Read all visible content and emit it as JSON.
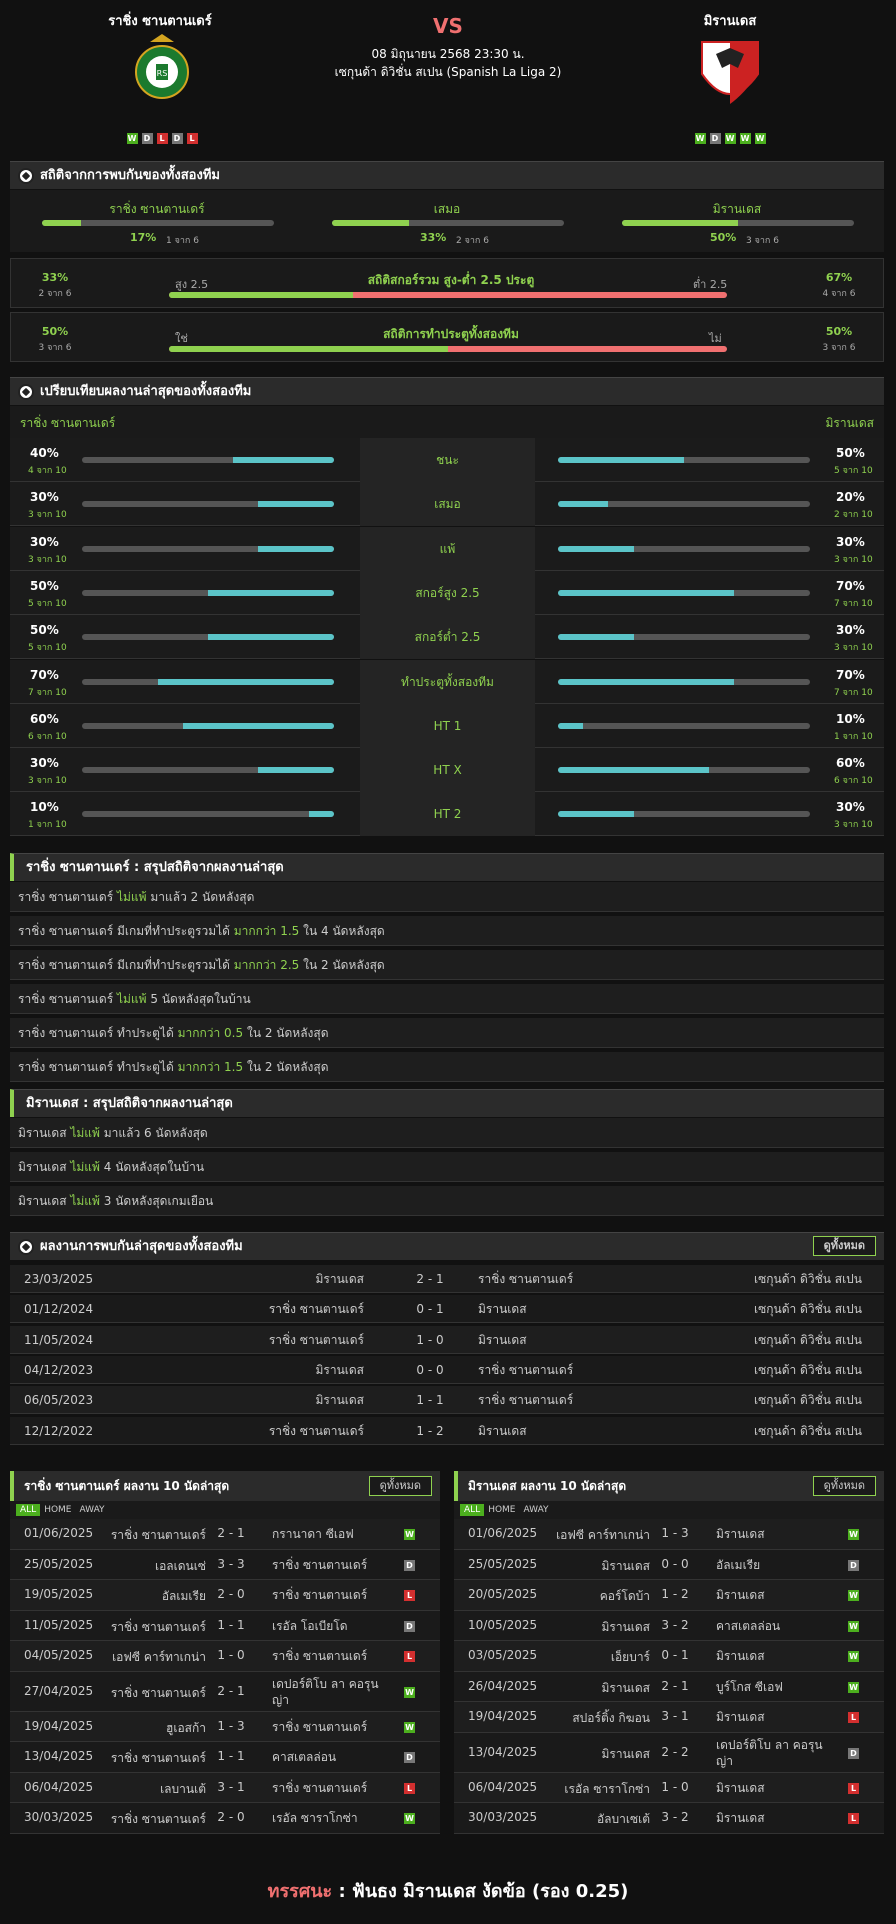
{
  "header": {
    "home_team": "ราชิ่ง ซานตานเดร์",
    "away_team": "มิรานเดส",
    "vs": "VS",
    "datetime": "08 มิถุนายน 2568 23:30 น.",
    "league": "เซกุนด้า ดิวิชั่น สเปน (Spanish La Liga 2)",
    "home_form": [
      "W",
      "D",
      "L",
      "D",
      "L"
    ],
    "away_form": [
      "W",
      "D",
      "W",
      "W",
      "W"
    ],
    "home_logo_text": "REAL RACING CLUB",
    "home_logo_sub": "SANTANDER"
  },
  "h2h_stats": {
    "title": "สถิติจากการพบกันของทั้งสองทีม",
    "items": [
      {
        "label": "ราชิ่ง ซานตานเดร์",
        "pct": "17%",
        "count": "1 จาก 6",
        "value": 0.17
      },
      {
        "label": "เสมอ",
        "pct": "33%",
        "count": "2 จาก 6",
        "value": 0.33
      },
      {
        "label": "มิรานเดส",
        "pct": "50%",
        "count": "3 จาก 6",
        "value": 0.5
      }
    ],
    "over_under": {
      "title": "สถิติสกอร์รวม สูง-ต่ำ 2.5 ประตู",
      "left_label": "สูง 2.5",
      "right_label": "ต่ำ 2.5",
      "left_pct": "33%",
      "left_count": "2 จาก 6",
      "right_pct": "67%",
      "right_count": "4 จาก 6",
      "value": 0.33
    },
    "btts": {
      "title": "สถิติการทำประตูทั้งสองทีม",
      "left_label": "ใช่",
      "right_label": "ไม่",
      "left_pct": "50%",
      "left_count": "3 จาก 6",
      "right_pct": "50%",
      "right_count": "3 จาก 6",
      "value": 0.5
    }
  },
  "compare": {
    "title": "เปรียบเทียบผลงานล่าสุดของทั้งสองทีม",
    "home": "ราชิ่ง ซานตานเดร์",
    "away": "มิรานเดส",
    "rows": [
      {
        "label": "ชนะ",
        "hp": "40%",
        "hc": "4 จาก 10",
        "hv": 0.4,
        "ap": "50%",
        "ac": "5 จาก 10",
        "av": 0.5
      },
      {
        "label": "เสมอ",
        "hp": "30%",
        "hc": "3 จาก 10",
        "hv": 0.3,
        "ap": "20%",
        "ac": "2 จาก 10",
        "av": 0.2
      },
      {
        "label": "แพ้",
        "hp": "30%",
        "hc": "3 จาก 10",
        "hv": 0.3,
        "ap": "30%",
        "ac": "3 จาก 10",
        "av": 0.3
      },
      {
        "label": "สกอร์สูง 2.5",
        "hp": "50%",
        "hc": "5 จาก 10",
        "hv": 0.5,
        "ap": "70%",
        "ac": "7 จาก 10",
        "av": 0.7
      },
      {
        "label": "สกอร์ต่ำ 2.5",
        "hp": "50%",
        "hc": "5 จาก 10",
        "hv": 0.5,
        "ap": "30%",
        "ac": "3 จาก 10",
        "av": 0.3
      },
      {
        "label": "ทำประตูทั้งสองทีม",
        "hp": "70%",
        "hc": "7 จาก 10",
        "hv": 0.7,
        "ap": "70%",
        "ac": "7 จาก 10",
        "av": 0.7
      },
      {
        "label": "HT 1",
        "hp": "60%",
        "hc": "6 จาก 10",
        "hv": 0.6,
        "ap": "10%",
        "ac": "1 จาก 10",
        "av": 0.1
      },
      {
        "label": "HT X",
        "hp": "30%",
        "hc": "3 จาก 10",
        "hv": 0.3,
        "ap": "60%",
        "ac": "6 จาก 10",
        "av": 0.6
      },
      {
        "label": "HT 2",
        "hp": "10%",
        "hc": "1 จาก 10",
        "hv": 0.1,
        "ap": "30%",
        "ac": "3 จาก 10",
        "av": 0.3
      }
    ]
  },
  "home_summary": {
    "title": "ราชิ่ง ซานตานเดร์ : สรุปสถิติจากผลงานล่าสุด",
    "rows": [
      [
        "ราชิ่ง ซานตานเดร์ ",
        "ไม่แพ้",
        " มาแล้ว 2 นัดหลังสุด"
      ],
      [
        "ราชิ่ง ซานตานเดร์ มีเกมที่ทำประตูรวมได้ ",
        "มากกว่า 1.5",
        " ใน 4 นัดหลังสุด"
      ],
      [
        "ราชิ่ง ซานตานเดร์ มีเกมที่ทำประตูรวมได้ ",
        "มากกว่า 2.5",
        " ใน 2 นัดหลังสุด"
      ],
      [
        "ราชิ่ง ซานตานเดร์ ",
        "ไม่แพ้",
        " 5 นัดหลังสุดในบ้าน"
      ],
      [
        "ราชิ่ง ซานตานเดร์ ทำประตูได้ ",
        "มากกว่า 0.5",
        " ใน 2 นัดหลังสุด"
      ],
      [
        "ราชิ่ง ซานตานเดร์ ทำประตูได้ ",
        "มากกว่า 1.5",
        " ใน 2 นัดหลังสุด"
      ]
    ]
  },
  "away_summary": {
    "title": "มิรานเดส : สรุปสถิติจากผลงานล่าสุด",
    "rows": [
      [
        "มิรานเดส ",
        "ไม่แพ้",
        " มาแล้ว 6 นัดหลังสุด"
      ],
      [
        "มิรานเดส ",
        "ไม่แพ้",
        " 4 นัดหลังสุดในบ้าน"
      ],
      [
        "มิรานเดส ",
        "ไม่แพ้",
        " 3 นัดหลังสุดเกมเยือน"
      ]
    ]
  },
  "h2h_matches": {
    "title": "ผลงานการพบกันล่าสุดของทั้งสองทีม",
    "view_all": "ดูทั้งหมด",
    "rows": [
      {
        "date": "23/03/2025",
        "home": "มิรานเดส",
        "score": "2 - 1",
        "away": "ราชิ่ง ซานตานเดร์",
        "league": "เซกุนด้า ดิวิชั่น สเปน"
      },
      {
        "date": "01/12/2024",
        "home": "ราชิ่ง ซานตานเดร์",
        "score": "0 - 1",
        "away": "มิรานเดส",
        "league": "เซกุนด้า ดิวิชั่น สเปน"
      },
      {
        "date": "11/05/2024",
        "home": "ราชิ่ง ซานตานเดร์",
        "score": "1 - 0",
        "away": "มิรานเดส",
        "league": "เซกุนด้า ดิวิชั่น สเปน"
      },
      {
        "date": "04/12/2023",
        "home": "มิรานเดส",
        "score": "0 - 0",
        "away": "ราชิ่ง ซานตานเดร์",
        "league": "เซกุนด้า ดิวิชั่น สเปน"
      },
      {
        "date": "06/05/2023",
        "home": "มิรานเดส",
        "score": "1 - 1",
        "away": "ราชิ่ง ซานตานเดร์",
        "league": "เซกุนด้า ดิวิชั่น สเปน"
      },
      {
        "date": "12/12/2022",
        "home": "ราชิ่ง ซานตานเดร์",
        "score": "1 - 2",
        "away": "มิรานเดส",
        "league": "เซกุนด้า ดิวิชั่น สเปน"
      }
    ]
  },
  "home_last10": {
    "title": "ราชิ่ง ซานตานเดร์ ผลงาน 10 นัดล่าสุด",
    "view_all": "ดูทั้งหมด",
    "tabs": [
      "ALL",
      "HOME",
      "AWAY"
    ],
    "rows": [
      {
        "date": "01/06/2025",
        "home": "ราชิ่ง ซานตานเดร์",
        "score": "2 - 1",
        "away": "กรานาดา ซีเอฟ",
        "res": "W"
      },
      {
        "date": "25/05/2025",
        "home": "เอลเดนเซ่",
        "score": "3 - 3",
        "away": "ราชิ่ง ซานตานเดร์",
        "res": "D"
      },
      {
        "date": "19/05/2025",
        "home": "อัลเมเรีย",
        "score": "2 - 0",
        "away": "ราชิ่ง ซานตานเดร์",
        "res": "L"
      },
      {
        "date": "11/05/2025",
        "home": "ราชิ่ง ซานตานเดร์",
        "score": "1 - 1",
        "away": "เรอัล โอเบียโด",
        "res": "D"
      },
      {
        "date": "04/05/2025",
        "home": "เอฟซี คาร์ทาเกน่า",
        "score": "1 - 0",
        "away": "ราชิ่ง ซานตานเดร์",
        "res": "L"
      },
      {
        "date": "27/04/2025",
        "home": "ราชิ่ง ซานตานเดร์",
        "score": "2 - 1",
        "away": "เดปอร์ติโบ ลา คอรุนญ่า",
        "res": "W"
      },
      {
        "date": "19/04/2025",
        "home": "ฮูเอสก้า",
        "score": "1 - 3",
        "away": "ราชิ่ง ซานตานเดร์",
        "res": "W"
      },
      {
        "date": "13/04/2025",
        "home": "ราชิ่ง ซานตานเดร์",
        "score": "1 - 1",
        "away": "คาสเตลล่อน",
        "res": "D"
      },
      {
        "date": "06/04/2025",
        "home": "เลบานเต้",
        "score": "3 - 1",
        "away": "ราชิ่ง ซานตานเดร์",
        "res": "L"
      },
      {
        "date": "30/03/2025",
        "home": "ราชิ่ง ซานตานเดร์",
        "score": "2 - 0",
        "away": "เรอัล ซาราโกซ่า",
        "res": "W"
      }
    ]
  },
  "away_last10": {
    "title": "มิรานเดส ผลงาน 10 นัดล่าสุด",
    "view_all": "ดูทั้งหมด",
    "tabs": [
      "ALL",
      "HOME",
      "AWAY"
    ],
    "rows": [
      {
        "date": "01/06/2025",
        "home": "เอฟซี คาร์ทาเกน่า",
        "score": "1 - 3",
        "away": "มิรานเดส",
        "res": "W"
      },
      {
        "date": "25/05/2025",
        "home": "มิรานเดส",
        "score": "0 - 0",
        "away": "อัลเมเรีย",
        "res": "D"
      },
      {
        "date": "20/05/2025",
        "home": "คอร์โดบ้า",
        "score": "1 - 2",
        "away": "มิรานเดส",
        "res": "W"
      },
      {
        "date": "10/05/2025",
        "home": "มิรานเดส",
        "score": "3 - 2",
        "away": "คาสเตลล่อน",
        "res": "W"
      },
      {
        "date": "03/05/2025",
        "home": "เอ็ยบาร์",
        "score": "0 - 1",
        "away": "มิรานเดส",
        "res": "W"
      },
      {
        "date": "26/04/2025",
        "home": "มิรานเดส",
        "score": "2 - 1",
        "away": "บูร์โกส ซีเอฟ",
        "res": "W"
      },
      {
        "date": "19/04/2025",
        "home": "สปอร์ติ้ง กิฆอน",
        "score": "3 - 1",
        "away": "มิรานเดส",
        "res": "L"
      },
      {
        "date": "13/04/2025",
        "home": "มิรานเดส",
        "score": "2 - 2",
        "away": "เดปอร์ติโบ ลา คอรุนญ่า",
        "res": "D"
      },
      {
        "date": "06/04/2025",
        "home": "เรอัล ซาราโกซ่า",
        "score": "1 - 0",
        "away": "มิรานเดส",
        "res": "L"
      },
      {
        "date": "30/03/2025",
        "home": "อัลบาเซเต้",
        "score": "3 - 2",
        "away": "มิรานเดส",
        "res": "L"
      }
    ]
  },
  "prediction": {
    "label": "ทรรศนะ",
    "colon": " : ",
    "text": "ฟันธง มิรานเดส งัดข้อ (รอง 0.25)"
  },
  "colors": {
    "accent": "#8fd14f",
    "cyan": "#5bc4c8",
    "red": "#f07070",
    "win": "#4caf1e",
    "loss": "#d32f2f",
    "draw": "#777777"
  }
}
